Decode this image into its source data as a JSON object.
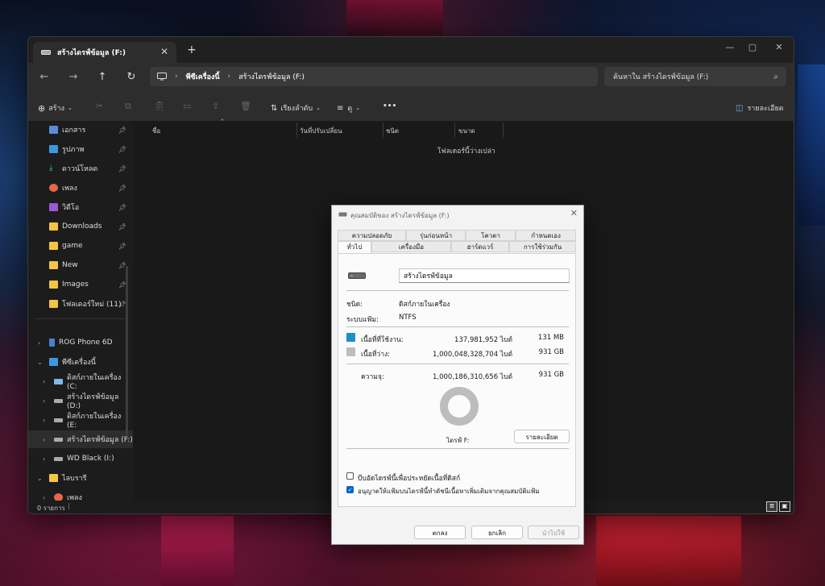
{
  "colors": {
    "used": "#1e90c8",
    "free": "#bdbdbd",
    "accent": "#0067c0"
  },
  "explorer": {
    "tab_title": "สร้างไดรฟ์ข้อมูล (F:)",
    "breadcrumb": [
      "พีซีเครื่องนี้",
      "สร้างไดรฟ์ข้อมูล (F:)"
    ],
    "search_placeholder": "ค้นหาใน สร้างไดรฟ์ข้อมูล (F:)",
    "toolbar": {
      "new_label": "สร้าง",
      "sort_label": "เรียงลำดับ",
      "view_label": "ดู",
      "more_label": "•••",
      "details_label": "รายละเอียด"
    },
    "quick_access": [
      {
        "label": "เอกสาร",
        "icon": "document-icon"
      },
      {
        "label": "รูปภาพ",
        "icon": "pictures-icon"
      },
      {
        "label": "ดาวน์โหลด",
        "icon": "download-icon"
      },
      {
        "label": "เพลง",
        "icon": "music-icon"
      },
      {
        "label": "วิดีโอ",
        "icon": "video-icon"
      },
      {
        "label": "Downloads",
        "icon": "folder-icon"
      },
      {
        "label": "game",
        "icon": "folder-icon"
      },
      {
        "label": "New",
        "icon": "folder-icon"
      },
      {
        "label": "Images",
        "icon": "folder-icon"
      },
      {
        "label": "โฟลเดอร์ใหม่ (11)",
        "icon": "folder-icon"
      }
    ],
    "tree": [
      {
        "label": "ROG Phone 6D",
        "icon": "phone-icon"
      },
      {
        "label": "พีซีเครื่องนี้",
        "icon": "pc-icon"
      },
      {
        "label": "ดิสก์ภายในเครื่อง (C:",
        "icon": "windows-drive-icon"
      },
      {
        "label": "สร้างไดรฟ์ข้อมูล (D:)",
        "icon": "drive-icon"
      },
      {
        "label": "ดิสก์ภายในเครื่อง (E:",
        "icon": "drive-icon"
      },
      {
        "label": "สร้างไดรฟ์ข้อมูล (F:)",
        "icon": "drive-icon"
      },
      {
        "label": "WD Black (I:)",
        "icon": "drive-icon"
      },
      {
        "label": "ไลบรารี",
        "icon": "library-icon"
      },
      {
        "label": "เพลง",
        "icon": "music-icon"
      }
    ],
    "columns": [
      "ชื่อ",
      "วันที่ปรับเปลี่ยน",
      "ชนิด",
      "ขนาด"
    ],
    "empty_message": "โฟลเดอร์นี้ว่างเปล่า",
    "status_count": "0 รายการ"
  },
  "dialog": {
    "title": "คุณสมบัติของ สร้างไดรฟ์ข้อมูล (F:)",
    "tabs_row1": [
      "ความปลอดภัย",
      "รุ่นก่อนหน้า",
      "โควตา",
      "กำหนดเอง"
    ],
    "tabs_row2": [
      "ทั่วไป",
      "เครื่องมือ",
      "ฮาร์ดแวร์",
      "การใช้ร่วมกัน"
    ],
    "drive_name": "สร้างไดรฟ์ข้อมูล",
    "type_label": "ชนิด:",
    "type_value": "ดิสก์ภายในเครื่อง",
    "fs_label": "ระบบแฟ้ม:",
    "fs_value": "NTFS",
    "used_label": "เนื้อที่ที่ใช้งาน:",
    "used_bytes": "137,981,952 ไบต์",
    "used_size": "131 MB",
    "free_label": "เนื้อที่ว่าง:",
    "free_bytes": "1,000,048,328,704 ไบต์",
    "free_size": "931 GB",
    "capacity_label": "ความจุ:",
    "capacity_bytes": "1,000,186,310,656 ไบต์",
    "capacity_size": "931 GB",
    "used_fraction": 0.000138,
    "drive_label": "ไดรฟ์ F:",
    "details_button": "รายละเอียด",
    "compress_label": "บีบอัดไดรฟ์นี้เพื่อประหยัดเนื้อที่ดิสก์",
    "index_label": "อนุญาตให้แฟ้มบนไดรฟ์นี้ทำดัชนีเนื้อหาเพิ่มเติมจากคุณสมบัติแฟ้ม",
    "ok": "ตกลง",
    "cancel": "ยกเลิก",
    "apply": "นำไปใช้"
  }
}
